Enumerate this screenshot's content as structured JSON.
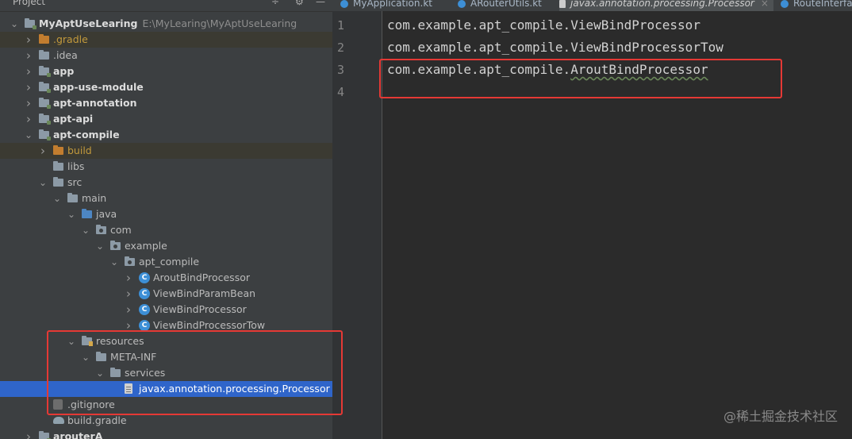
{
  "project_pane": {
    "header_title": "Project",
    "header_buttons": [
      "÷",
      "⚙",
      "—"
    ]
  },
  "tree": [
    {
      "label": "MyAptUseLearing",
      "hint": "E:\\MyLearing\\MyAptUseLearing",
      "icon": "module-folder-icon",
      "bold": true,
      "arrow": "open"
    },
    {
      "label": ".gradle",
      "icon": "folder-icon",
      "color": "orange",
      "arrow": "closed",
      "excluded": true
    },
    {
      "label": ".idea",
      "icon": "folder-icon",
      "arrow": "closed"
    },
    {
      "label": "app",
      "icon": "module-folder-icon",
      "bold": true,
      "arrow": "closed"
    },
    {
      "label": "app-use-module",
      "icon": "module-folder-icon",
      "bold": true,
      "arrow": "closed"
    },
    {
      "label": "apt-annotation",
      "icon": "module-folder-icon",
      "bold": true,
      "arrow": "closed"
    },
    {
      "label": "apt-api",
      "icon": "module-folder-icon",
      "bold": true,
      "arrow": "closed"
    },
    {
      "label": "apt-compile",
      "icon": "module-folder-icon",
      "bold": true,
      "arrow": "open"
    },
    {
      "label": "build",
      "icon": "folder-icon",
      "color": "orange",
      "arrow": "closed",
      "excluded": true
    },
    {
      "label": "libs",
      "icon": "folder-icon",
      "arrow": "none"
    },
    {
      "label": "src",
      "icon": "folder-icon",
      "arrow": "open"
    },
    {
      "label": "main",
      "icon": "folder-icon",
      "arrow": "open"
    },
    {
      "label": "java",
      "icon": "source-folder-icon",
      "arrow": "open"
    },
    {
      "label": "com",
      "icon": "package-icon",
      "arrow": "open"
    },
    {
      "label": "example",
      "icon": "package-icon",
      "arrow": "open"
    },
    {
      "label": "apt_compile",
      "icon": "package-icon",
      "arrow": "open"
    },
    {
      "label": "AroutBindProcessor",
      "icon": "kotlin-class-icon",
      "arrow": "closed"
    },
    {
      "label": "ViewBindParamBean",
      "icon": "kotlin-class-icon",
      "arrow": "closed"
    },
    {
      "label": "ViewBindProcessor",
      "icon": "kotlin-class-icon",
      "arrow": "closed"
    },
    {
      "label": "ViewBindProcessorTow",
      "icon": "kotlin-class-icon",
      "arrow": "closed"
    },
    {
      "label": "resources",
      "icon": "resources-folder-icon",
      "arrow": "open"
    },
    {
      "label": "META-INF",
      "icon": "folder-icon",
      "arrow": "open"
    },
    {
      "label": "services",
      "icon": "folder-icon",
      "arrow": "open"
    },
    {
      "label": "javax.annotation.processing.Processor",
      "icon": "text-file-icon",
      "arrow": "none",
      "selected": true
    },
    {
      "label": ".gitignore",
      "icon": "gitignore-file-icon",
      "arrow": "none"
    },
    {
      "label": "build.gradle",
      "icon": "gradle-file-icon",
      "arrow": "none"
    },
    {
      "label": "arouterA",
      "icon": "module-folder-icon",
      "bold": true,
      "arrow": "closed"
    }
  ],
  "tabs": [
    {
      "label": "MyApplication.kt",
      "icon": "kotlin-class-icon"
    },
    {
      "label": "ARouterUtils.kt",
      "icon": "kotlin-class-icon"
    },
    {
      "label": "javax.annotation.processing.Processor",
      "icon": "text-file-icon",
      "active": true
    },
    {
      "label": "RouteInterfa",
      "icon": "kotlin-class-icon"
    }
  ],
  "tab_close_glyph": "×",
  "editor": {
    "line_numbers": [
      "1",
      "2",
      "3",
      "4"
    ],
    "lines": [
      {
        "prefix": "com.example.apt_compile.ViewBindProcessor",
        "squiggle": ""
      },
      {
        "prefix": "com.example.apt_compile.ViewBindProcessorTow",
        "squiggle": ""
      },
      {
        "prefix": "com.example.apt_compile.",
        "squiggle": "AroutBindProcessor"
      },
      {
        "prefix": "",
        "squiggle": ""
      }
    ]
  },
  "watermark": "@稀土掘金技术社区",
  "colors": {
    "annotation_red": "#e53935",
    "selection_blue": "#2f65ca",
    "excluded_orange": "#c39a3c"
  }
}
